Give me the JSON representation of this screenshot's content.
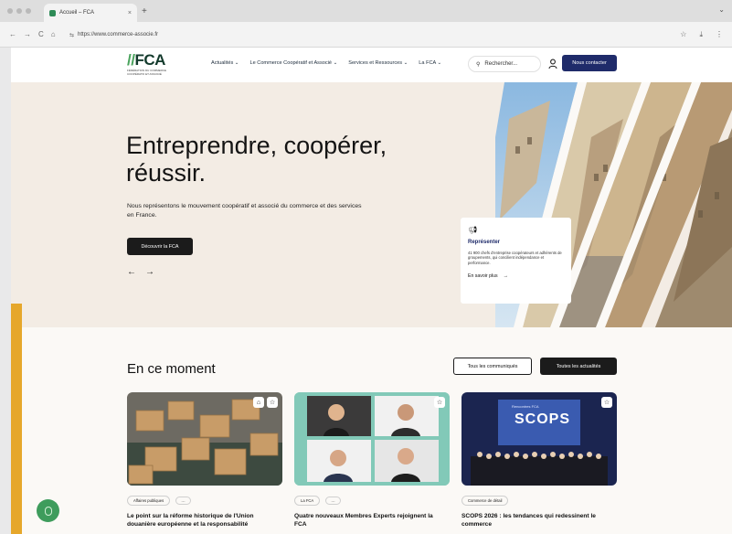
{
  "browser": {
    "tab_title": "Accueil – FCA",
    "url": "https://www.commerce-associe.fr"
  },
  "header": {
    "logo_text": "FCA",
    "logo_sub": "FÉDÉRATION DU COMMERCE COOPÉRATIF ET ASSOCIÉ",
    "nav": [
      "Actualités ⌄",
      "Le Commerce Coopératif et Associé ⌄",
      "Services et Ressources ⌄",
      "La FCA ⌄"
    ],
    "search_placeholder": "Rechercher...",
    "contact_label": "Nous contacter"
  },
  "hero": {
    "title": "Entreprendre, coopérer, réussir.",
    "description": "Nous représentons le mouvement coopératif et associé du commerce et des services en France.",
    "cta_label": "Découvrir la FCA",
    "card": {
      "title": "Représenter",
      "text": "41 900 chefs d'entreprise coopérateurs et adhérents de groupements, qui concilient indépendance et performance.",
      "link": "En savoir plus"
    }
  },
  "section": {
    "title": "En ce moment",
    "btn_communiques": "Tous les communiqués",
    "btn_actualites": "Toutes les actualités"
  },
  "news": [
    {
      "tag": "Affaires publiques",
      "title": "Le point sur la réforme historique de l'Union douanière européenne et la responsabilité"
    },
    {
      "tag": "La FCA",
      "title": "Quatre nouveaux Membres Experts rejoignent la FCA"
    },
    {
      "tag": "Commerce de détail",
      "title": "SCOPS 2026 : les tendances qui redessinent le commerce"
    }
  ],
  "banner_text": {
    "small": "Rencontres FCA",
    "big": "SCOPS"
  },
  "colors": {
    "brand_navy": "#1f2b6a",
    "brand_green": "#3e9c5c",
    "accent_gold": "#e6a72b"
  }
}
